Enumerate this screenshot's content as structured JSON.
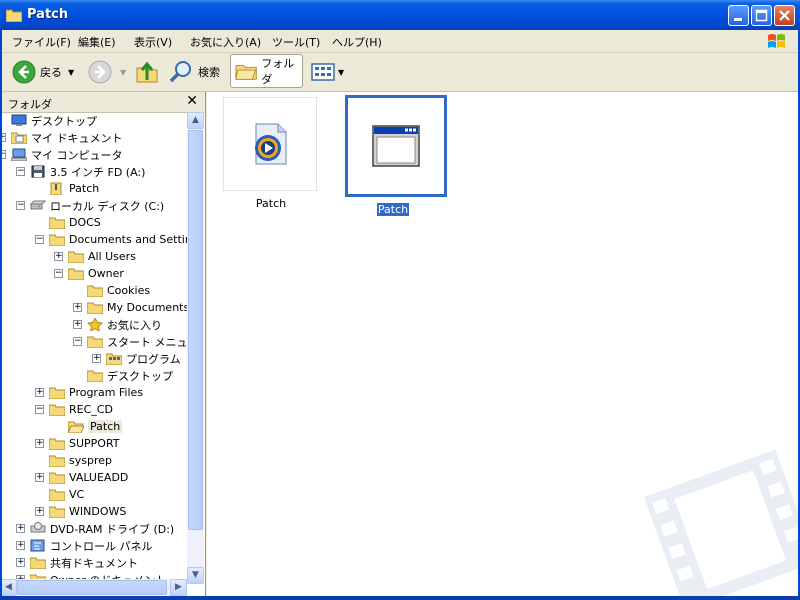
{
  "window": {
    "title": "Patch"
  },
  "menu": [
    "ファイル(F)",
    "編集(E)",
    "表示(V)",
    "お気に入り(A)",
    "ツール(T)",
    "ヘルプ(H)"
  ],
  "toolbar": {
    "back_label": "戻る",
    "search_label": "検索",
    "folders_label": "フォルダ"
  },
  "left_pane": {
    "title": "フォルダ",
    "close_glyph": "✕",
    "tree": [
      {
        "label": "デスクトップ",
        "depth": 0,
        "exp": "none",
        "icon": "desktop-icon"
      },
      {
        "label": "マイ ドキュメント",
        "depth": 0,
        "exp": "+",
        "icon": "my-documents-icon"
      },
      {
        "label": "マイ コンピュータ",
        "depth": 0,
        "exp": "−",
        "icon": "my-computer-icon"
      },
      {
        "label": "3.5 インチ FD (A:)",
        "depth": 1,
        "exp": "−",
        "icon": "floppy-icon"
      },
      {
        "label": "Patch",
        "depth": 2,
        "exp": "none",
        "icon": "zip-folder-icon"
      },
      {
        "label": "ローカル ディスク (C:)",
        "depth": 1,
        "exp": "−",
        "icon": "hard-disk-icon"
      },
      {
        "label": "DOCS",
        "depth": 2,
        "exp": "none",
        "icon": "folder-icon"
      },
      {
        "label": "Documents and Settin",
        "depth": 2,
        "exp": "−",
        "icon": "folder-icon"
      },
      {
        "label": "All Users",
        "depth": 3,
        "exp": "+",
        "icon": "folder-icon"
      },
      {
        "label": "Owner",
        "depth": 3,
        "exp": "−",
        "icon": "folder-icon"
      },
      {
        "label": "Cookies",
        "depth": 4,
        "exp": "none",
        "icon": "folder-icon"
      },
      {
        "label": "My Documents",
        "depth": 4,
        "exp": "+",
        "icon": "folder-icon"
      },
      {
        "label": "お気に入り",
        "depth": 4,
        "exp": "+",
        "icon": "favorites-star-icon"
      },
      {
        "label": "スタート メニュー",
        "depth": 4,
        "exp": "−",
        "icon": "folder-icon"
      },
      {
        "label": "プログラム",
        "depth": 5,
        "exp": "+",
        "icon": "programs-folder-icon"
      },
      {
        "label": "デスクトップ",
        "depth": 4,
        "exp": "none",
        "icon": "folder-icon"
      },
      {
        "label": "Program Files",
        "depth": 2,
        "exp": "+",
        "icon": "folder-icon"
      },
      {
        "label": "REC_CD",
        "depth": 2,
        "exp": "−",
        "icon": "folder-icon"
      },
      {
        "label": "Patch",
        "depth": 3,
        "exp": "none",
        "icon": "folder-open-icon",
        "selected": true
      },
      {
        "label": "SUPPORT",
        "depth": 2,
        "exp": "+",
        "icon": "folder-icon"
      },
      {
        "label": "sysprep",
        "depth": 2,
        "exp": "none",
        "icon": "folder-icon"
      },
      {
        "label": "VALUEADD",
        "depth": 2,
        "exp": "+",
        "icon": "folder-icon"
      },
      {
        "label": "VC",
        "depth": 2,
        "exp": "none",
        "icon": "folder-icon"
      },
      {
        "label": "WINDOWS",
        "depth": 2,
        "exp": "+",
        "icon": "folder-icon"
      },
      {
        "label": "DVD-RAM ドライブ (D:)",
        "depth": 1,
        "exp": "+",
        "icon": "dvd-drive-icon"
      },
      {
        "label": "コントロール パネル",
        "depth": 1,
        "exp": "+",
        "icon": "control-panel-icon"
      },
      {
        "label": "共有ドキュメント",
        "depth": 1,
        "exp": "+",
        "icon": "folder-icon"
      },
      {
        "label": "Owner のドキュメント",
        "depth": 1,
        "exp": "+",
        "icon": "folder-icon"
      }
    ]
  },
  "files": [
    {
      "label": "Patch",
      "icon": "media-player-file-icon",
      "selected": false
    },
    {
      "label": "Patch",
      "icon": "application-window-icon",
      "selected": true
    }
  ],
  "colors": {
    "titlebar": "#0054e3",
    "selection": "#316ac5",
    "folder": "#f5d878"
  }
}
